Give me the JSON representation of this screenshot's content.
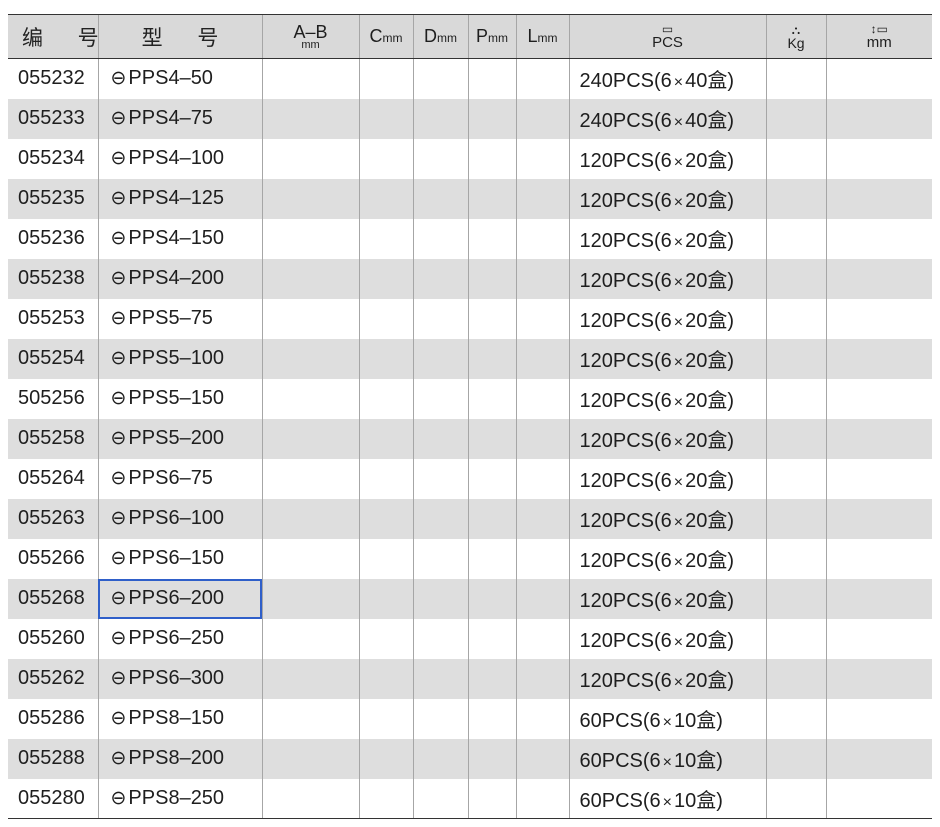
{
  "headers": {
    "code": "编 号",
    "model": "型 号",
    "ab_main": "A–B",
    "ab_unit": "mm",
    "c_main": "C",
    "d_main": "D",
    "p_main": "P",
    "l_main": "L",
    "col_unit": "mm",
    "pcs_icon": "▭",
    "pcs_label": "PCS",
    "kg_icon": "⛬",
    "kg_label": "Kg",
    "dim_icon": "↕▭",
    "dim_label": "mm"
  },
  "rows": [
    {
      "code": "055232",
      "model": "PPS4–50",
      "pcs": "240PCS(6",
      "x": "×",
      "box": "40盒)"
    },
    {
      "code": "055233",
      "model": "PPS4–75",
      "pcs": "240PCS(6",
      "x": "×",
      "box": "40盒)"
    },
    {
      "code": "055234",
      "model": "PPS4–100",
      "pcs": "120PCS(6",
      "x": "×",
      "box": "20盒)"
    },
    {
      "code": "055235",
      "model": "PPS4–125",
      "pcs": "120PCS(6",
      "x": "×",
      "box": "20盒)"
    },
    {
      "code": "055236",
      "model": "PPS4–150",
      "pcs": "120PCS(6",
      "x": "×",
      "box": "20盒)"
    },
    {
      "code": "055238",
      "model": "PPS4–200",
      "pcs": "120PCS(6",
      "x": "×",
      "box": "20盒)"
    },
    {
      "code": "055253",
      "model": "PPS5–75",
      "pcs": "120PCS(6",
      "x": "×",
      "box": "20盒)"
    },
    {
      "code": "055254",
      "model": "PPS5–100",
      "pcs": "120PCS(6",
      "x": "×",
      "box": "20盒)"
    },
    {
      "code": "505256",
      "model": "PPS5–150",
      "pcs": "120PCS(6",
      "x": "×",
      "box": "20盒)"
    },
    {
      "code": "055258",
      "model": "PPS5–200",
      "pcs": "120PCS(6",
      "x": "×",
      "box": "20盒)"
    },
    {
      "code": "055264",
      "model": "PPS6–75",
      "pcs": "120PCS(6",
      "x": "×",
      "box": "20盒)"
    },
    {
      "code": "055263",
      "model": "PPS6–100",
      "pcs": "120PCS(6",
      "x": "×",
      "box": "20盒)"
    },
    {
      "code": "055266",
      "model": "PPS6–150",
      "pcs": "120PCS(6",
      "x": "×",
      "box": "20盒)"
    },
    {
      "code": "055268",
      "model": "PPS6–200",
      "pcs": "120PCS(6",
      "x": "×",
      "box": "20盒)"
    },
    {
      "code": "055260",
      "model": "PPS6–250",
      "pcs": "120PCS(6",
      "x": "×",
      "box": "20盒)"
    },
    {
      "code": "055262",
      "model": "PPS6–300",
      "pcs": "120PCS(6",
      "x": "×",
      "box": "20盒)"
    },
    {
      "code": "055286",
      "model": "PPS8–150",
      "pcs": "60PCS(6",
      "x": "×",
      "box": "10盒)"
    },
    {
      "code": "055288",
      "model": "PPS8–200",
      "pcs": "60PCS(6",
      "x": "×",
      "box": "10盒)"
    },
    {
      "code": "055280",
      "model": "PPS8–250",
      "pcs": "60PCS(6",
      "x": "×",
      "box": "10盒)"
    }
  ],
  "selected_row": 13,
  "model_symbol": "⊖",
  "colors": {
    "selection": "#2f5fc9",
    "stripe": "#dedede",
    "header_bg": "#d9d9d9"
  }
}
